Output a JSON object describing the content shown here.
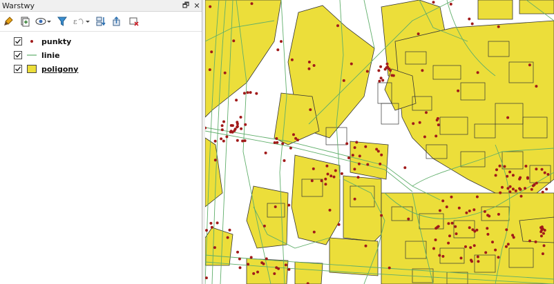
{
  "panel": {
    "title": "Warstwy",
    "float_glyph": "🗗",
    "close_glyph": "✕"
  },
  "toolbar": {
    "tools": [
      {
        "name": "style-brush-icon"
      },
      {
        "name": "add-group-icon"
      },
      {
        "name": "visibility-eye-icon"
      },
      {
        "name": "filter-funnel-icon"
      },
      {
        "name": "expression-filter-icon"
      },
      {
        "name": "expand-all-icon"
      },
      {
        "name": "collapse-all-icon"
      },
      {
        "name": "remove-layer-icon"
      }
    ]
  },
  "layers": [
    {
      "label": "punkty",
      "checked": true,
      "symbol": "point",
      "color": "#a11a1a"
    },
    {
      "label": "linie",
      "checked": true,
      "symbol": "line",
      "color": "#5fae6a"
    },
    {
      "label": "poligony",
      "checked": true,
      "symbol": "polygon",
      "color": "#ecde3a"
    }
  ],
  "map_colors": {
    "background": "#ffffff",
    "polygon_fill": "#ecde3a",
    "polygon_stroke": "#333333",
    "line_color": "#5fae6a",
    "point_color": "#a11a1a"
  }
}
